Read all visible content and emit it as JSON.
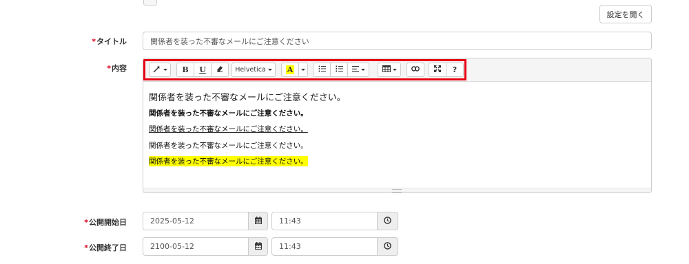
{
  "settings_button": "設定を開く",
  "required_mark": "*",
  "title_field": {
    "label": "タイトル",
    "value": "関係者を装った不審なメールにご注意ください"
  },
  "content_field": {
    "label": "内容"
  },
  "toolbar": {
    "style_icon": "magic-wand-icon",
    "bold": "B",
    "underline": "U",
    "eraser_icon": "eraser-icon",
    "font_name": "Helvetica",
    "color_letter": "A",
    "color_highlight": "#ffff00",
    "unordered_list_icon": "unordered-list-icon",
    "ordered_list_icon": "ordered-list-icon",
    "align_icon": "align-left-icon",
    "table_icon": "table-icon",
    "link_icon": "link-icon",
    "fullscreen_icon": "fullscreen-icon",
    "help": "?",
    "highlight_color": "#e60012"
  },
  "editor_lines": [
    "関係者を装った不審なメールにご注意ください。",
    "関係者を装った不審なメールにご注意ください。",
    "関係者を装った不審なメールにご注意ください。",
    "関係者を装った不審なメールにご注意ください。",
    "関係者を装った不審なメールにご注意ください。"
  ],
  "publish_start": {
    "label": "公開開始日",
    "date": "2025-05-12",
    "time": "11:43"
  },
  "publish_end": {
    "label": "公開終了日",
    "date": "2100-05-12",
    "time": "11:43"
  }
}
